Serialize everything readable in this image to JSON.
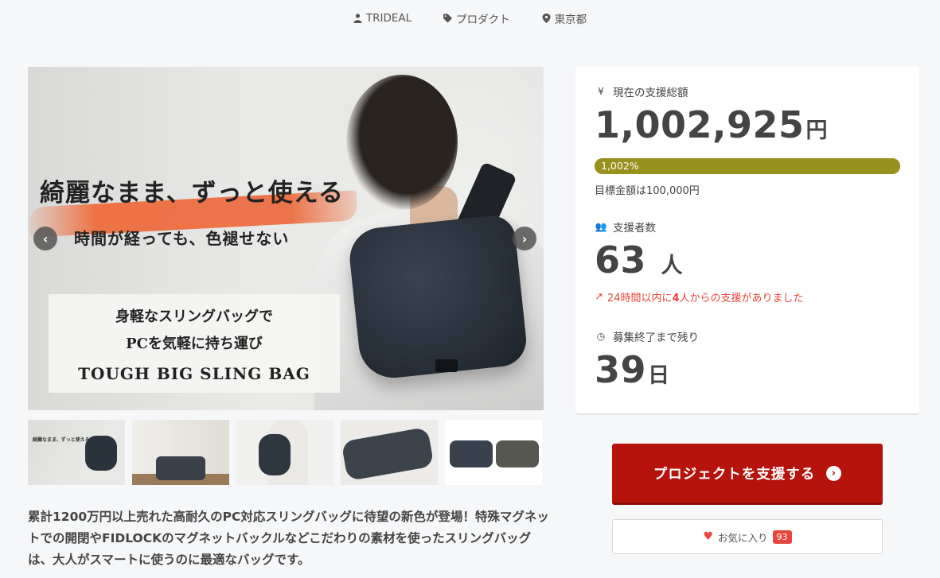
{
  "meta": {
    "owner": "TRIDEAL",
    "category": "プロダクト",
    "location": "東京都"
  },
  "hero": {
    "headline": "綺麗なまま、ずっと使える",
    "subline": "時間が経っても、色褪せない",
    "panel_line1": "身軽なスリングバッグで",
    "panel_line2": "PCを気軽に持ち運び",
    "panel_line3": "TOUGH BIG SLING BAG",
    "prev_icon": "chevron-left-icon",
    "next_icon": "chevron-right-icon"
  },
  "thumbnails": [
    {
      "name": "thumbnail-1",
      "mini_text": "綺麗なまま、ずっと使える"
    },
    {
      "name": "thumbnail-2"
    },
    {
      "name": "thumbnail-3"
    },
    {
      "name": "thumbnail-4"
    },
    {
      "name": "thumbnail-5"
    }
  ],
  "description": "累計1200万円以上売れた高耐久のPC対応スリングバッグに待望の新色が登場！特殊マグネットでの開閉やFIDLOCKのマグネットバックルなどこだわりの素材を使ったスリングバッグは、大人がスマートに使うのに最適なバッグです。",
  "stats": {
    "total_label": "現在の支援総額",
    "total_value": "1,002,925",
    "total_unit": "円",
    "progress_text": "1,002%",
    "progress_fraction": 1.0,
    "goal_text": "目標金額は100,000円",
    "backers_label": "支援者数",
    "backers_value": "63",
    "backers_unit": "人",
    "trend_prefix": "24時間以内に",
    "trend_count": "4",
    "trend_suffix": "人からの支援がありました",
    "remaining_label": "募集終了まで残り",
    "remaining_value": "39",
    "remaining_unit": "日"
  },
  "actions": {
    "support_label": "プロジェクトを支援する",
    "favorite_label": "お気に入り",
    "favorite_count": "93"
  },
  "colors": {
    "accent_red": "#b5130b",
    "progress": "#99911d",
    "trend_red": "#e8453c"
  }
}
